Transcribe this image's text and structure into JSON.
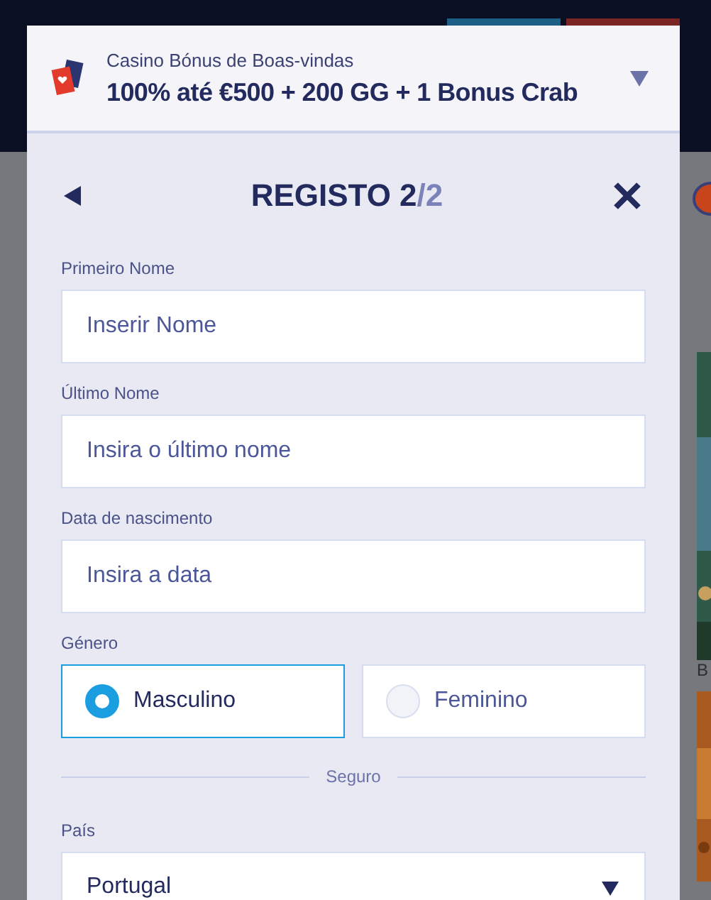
{
  "backdrop": {
    "side_text": "B"
  },
  "bonus": {
    "category": "Casino Bónus de Boas-vindas",
    "offer": "100% até €500 + 200 GG + 1 Bonus Crab",
    "expanded": false
  },
  "form": {
    "title": "REGISTO 2",
    "step_total": "/2",
    "fields": [
      {
        "label": "Primeiro Nome",
        "placeholder": "Inserir Nome"
      },
      {
        "label": "Último Nome",
        "placeholder": "Insira o último nome"
      },
      {
        "label": "Data de nascimento",
        "placeholder": "Insira a data"
      }
    ],
    "gender": {
      "label": "Género",
      "options": [
        {
          "label": "Masculino",
          "selected": true
        },
        {
          "label": "Feminino",
          "selected": false
        }
      ]
    },
    "divider": "Seguro",
    "country": {
      "label": "País",
      "value": "Portugal"
    }
  }
}
